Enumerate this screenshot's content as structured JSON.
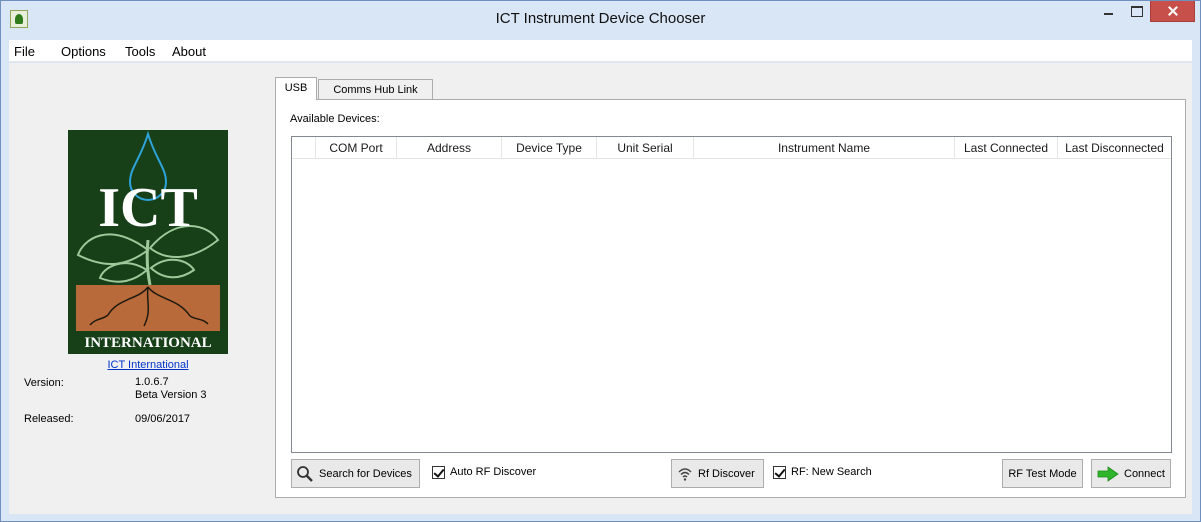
{
  "window": {
    "title": "ICT Instrument Device Chooser"
  },
  "menu": [
    "File",
    "Options",
    "Tools",
    "About"
  ],
  "sidebar": {
    "logo_top": "ICT",
    "logo_bottom": "INTERNATIONAL",
    "link": "ICT International",
    "version_label": "Version:",
    "version": "1.0.6.7",
    "version_sub": "Beta Version 3",
    "released_label": "Released:",
    "released": "09/06/2017"
  },
  "tabs": {
    "active": "USB",
    "inactive": "Comms Hub Link"
  },
  "devices": {
    "label": "Available Devices:",
    "columns": [
      "COM Port",
      "Address",
      "Device Type",
      "Unit Serial",
      "Instrument Name",
      "Last Connected",
      "Last Disconnected"
    ],
    "rows": []
  },
  "footer": {
    "search": "Search for Devices",
    "auto_rf": "Auto RF Discover",
    "rf_discover": "Rf Discover",
    "rf_new_search": "RF: New Search",
    "rf_test_mode": "RF Test Mode",
    "connect": "Connect"
  },
  "colors": {
    "logo_green": "#173f18",
    "soil": "#b96a3a",
    "connect_arrow": "#2fb52b"
  }
}
